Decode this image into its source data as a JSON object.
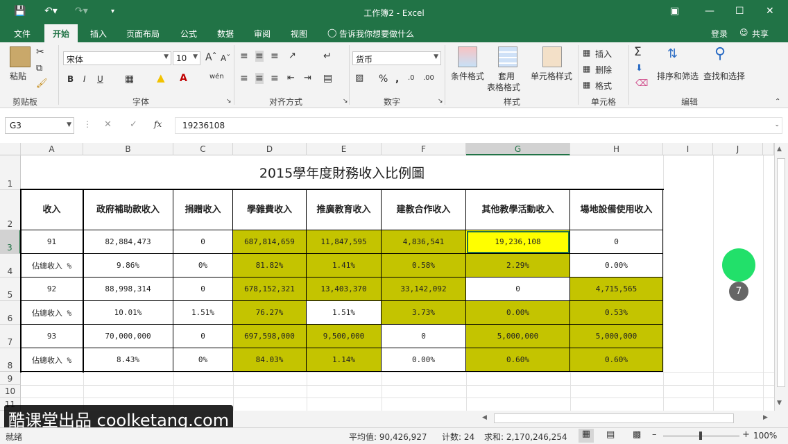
{
  "window": {
    "title": "工作簿2 - Excel",
    "login": "登录",
    "share": "共享",
    "tell_me": "告诉我你想要做什么"
  },
  "tabs": [
    "文件",
    "开始",
    "插入",
    "页面布局",
    "公式",
    "数据",
    "审阅",
    "视图"
  ],
  "ribbon": {
    "clipboard": {
      "label": "剪贴板",
      "paste": "粘贴"
    },
    "font": {
      "label": "字体",
      "name": "宋体",
      "size": "10"
    },
    "alignment": {
      "label": "对齐方式"
    },
    "number": {
      "label": "数字",
      "format": "货币"
    },
    "styles": {
      "label": "样式",
      "conditional": "条件格式",
      "table1": "套用",
      "table2": "表格格式",
      "cell_styles": "单元格样式"
    },
    "cells": {
      "label": "单元格",
      "insert": "插入",
      "delete": "删除",
      "format": "格式"
    },
    "editing": {
      "label": "编辑",
      "sort": "排序和筛选",
      "find": "查找和选择"
    }
  },
  "formula_bar": {
    "name_box": "G3",
    "value": "19236108",
    "fx": "fx"
  },
  "grid": {
    "columns": [
      "A",
      "B",
      "C",
      "D",
      "E",
      "F",
      "G",
      "H",
      "I",
      "J"
    ],
    "rows": [
      "1",
      "2",
      "3",
      "4",
      "5",
      "6",
      "7",
      "8",
      "9",
      "10",
      "11"
    ],
    "title": "2015學年度財務收入比例圖",
    "headers": [
      "收入",
      "政府補助款收入",
      "捐贈收入",
      "學雜費收入",
      "推廣教育收入",
      "建教合作收入",
      "其他教學活動收入",
      "場地設備使用收入"
    ],
    "data": [
      [
        "91",
        "82,884,473",
        "0",
        "687,814,659",
        "11,847,595",
        "4,836,541",
        "19,236,108",
        "0"
      ],
      [
        "佔總收入 %",
        "9.86%",
        "0%",
        "81.82%",
        "1.41%",
        "0.58%",
        "2.29%",
        "0.00%"
      ],
      [
        "92",
        "88,998,314",
        "0",
        "678,152,321",
        "13,403,370",
        "33,142,092",
        "0",
        "4,715,565"
      ],
      [
        "佔總收入 %",
        "10.01%",
        "1.51%",
        "76.27%",
        "1.51%",
        "3.73%",
        "0.00%",
        "0.53%"
      ],
      [
        "93",
        "70,000,000",
        "0",
        "697,598,000",
        "9,500,000",
        "0",
        "5,000,000",
        "5,000,000"
      ],
      [
        "佔總收入 %",
        "8.43%",
        "0%",
        "84.03%",
        "1.14%",
        "0.00%",
        "0.60%",
        "0.60%"
      ]
    ]
  },
  "overlay": {
    "step": "7",
    "watermark": "酷课堂出品 coolketang.com"
  },
  "status": {
    "ready": "就绪",
    "average": "平均值: 90,426,927",
    "count": "计数: 24",
    "sum": "求和: 2,170,246,254",
    "zoom": "100%"
  },
  "colors": {
    "excel_green": "#217346",
    "olive": "#c4c400",
    "highlight": "#ffff00",
    "cursor": "#22e06a"
  }
}
